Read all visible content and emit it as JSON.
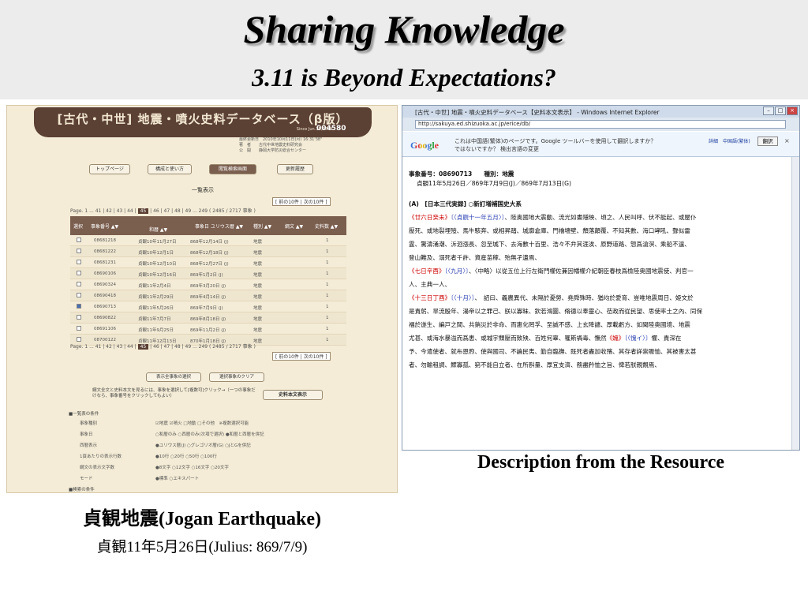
{
  "slide": {
    "title": "Sharing Knowledge",
    "subtitle": "3.11 is Beyond Expectations?",
    "caption_right": "Description from the Resource",
    "caption_left_title": "貞観地震(Jogan Earthquake)",
    "caption_left_date": "貞観11年5月26日(Julius: 869/7/9)"
  },
  "left_db": {
    "header_title": "[古代・中世] 地震・噴火史料データベース（β版）",
    "since": "Since Jun.15,2009",
    "counter": "004580",
    "meta_lines": [
      "最終更新日　2010年10月11日(月) 16:31'38\"",
      "著　者　　古代中世地震史料研究会",
      "公　開　　静岡大学防災総合センター"
    ],
    "buttons": [
      "トップページ",
      "構成と使い方",
      "閲覧検索画面",
      "更新履歴"
    ],
    "section_label": "一覧表示",
    "nav_prev_next": "[ 前の10件 | 次の10件 ]",
    "pager_prefix": "Page. 1 ... 41 | 42 | 43 | 44 |",
    "pager_current": "45",
    "pager_suffix": "| 46 | 47 | 48 | 49 ... 249",
    "pager_count": "( 2485 / 2717 事象 )",
    "table_headers": [
      "選択",
      "事象番号 ▲▼",
      "和暦 ▲▼",
      "事象日 ユリウス暦 ▲▼",
      "種別 ▲▼",
      "綱文 ▲▼",
      "史料数 ▲▼"
    ],
    "rows": [
      {
        "id": "08681218",
        "wareki": "貞観10年11月27日",
        "julius": "868年12月14日 (J)",
        "type": "地震",
        "count": "1",
        "checked": false
      },
      {
        "id": "08681222",
        "wareki": "貞観10年12月1日",
        "julius": "868年12月18日 (J)",
        "type": "地震",
        "count": "1",
        "checked": false
      },
      {
        "id": "08681231",
        "wareki": "貞観10年12月10日",
        "julius": "868年12月27日 (J)",
        "type": "地震",
        "count": "1",
        "checked": false
      },
      {
        "id": "08690106",
        "wareki": "貞観10年12月16日",
        "julius": "869年1月2日 (J)",
        "type": "地震",
        "count": "1",
        "checked": false
      },
      {
        "id": "08690324",
        "wareki": "貞観11年2月4日",
        "julius": "869年3月20日 (J)",
        "type": "地震",
        "count": "1",
        "checked": false
      },
      {
        "id": "08690418",
        "wareki": "貞観11年2月29日",
        "julius": "869年4月14日 (J)",
        "type": "地震",
        "count": "1",
        "checked": false
      },
      {
        "id": "08690713",
        "wareki": "貞観11年5月26日",
        "julius": "869年7月9日 (J)",
        "type": "地震",
        "count": "1",
        "checked": true
      },
      {
        "id": "08690822",
        "wareki": "貞観11年7月7日",
        "julius": "869年8月18日 (J)",
        "type": "地震",
        "count": "1",
        "checked": false
      },
      {
        "id": "08691106",
        "wareki": "貞観11年9月25日",
        "julius": "869年11月2日 (J)",
        "type": "地震",
        "count": "1",
        "checked": false
      },
      {
        "id": "08700122",
        "wareki": "貞観11年12月13日",
        "julius": "870年1月18日 (J)",
        "type": "地震",
        "count": "1",
        "checked": false
      }
    ],
    "select_all": "表示全事象の選択",
    "clear_selection": "選択事象のクリア",
    "note": "綱文全文と史料本文を見るには、事象を選択して[複数可]クリック→（一つの事象だけなら、事象番号をクリックしてもよい）",
    "view_button": "史料本文表示",
    "conditions_title": "■一覧表の条件",
    "conditions": [
      {
        "label": "事象種別",
        "value": "☑地震 ☑噴火 □地動 □その他　※複数選択可能"
      },
      {
        "label": "事象日",
        "value": "○和暦のみ ○西暦のみ(次項で選択) ●和暦と西暦を併記"
      },
      {
        "label": "西暦表示",
        "value": "●ユリウス暦(J) ○グレゴリオ暦(G) ○JとGを併記"
      },
      {
        "label": "1頁あたりの表示行数",
        "value": "●10行 ○20行 ○50行 ○100行"
      },
      {
        "label": "綱文の表示文字数",
        "value": "●8文字 ○12文字 ○16文字 ○20文字"
      },
      {
        "label": "モード",
        "value": "●標準 ○エキスパート"
      }
    ],
    "search_title": "■検索の条件"
  },
  "right_ie": {
    "window_title": "[古代・中世] 地震・噴火史料データベース【史料本文表示】 - Windows Internet Explorer",
    "url": "http://sakuya.ed.shizuoka.ac.jp/erice/db/",
    "google_logo": "Google",
    "translate_line1": "これは中国語(繁体)のページです。Google ツールバーを使用して翻訳しますか？",
    "translate_line2": "ではないですか？ 検出言語の変更",
    "translate_detail": "詳細　中国語(繁体)",
    "translate_button": "翻訳",
    "event_no": "事象番号：08690713　　種別：地震",
    "event_date": "貞観11年5月26日／869年7月9日(J)／869年7月13日(G)",
    "source_title": "(A)　[日本三代実録] ○新訂増補国史大系",
    "lines": [
      "《廿六日癸未》〔〈貞觀十一年五月〉〕、陸奥國地大震動、流光如晝隱映、頃之、人民叫呼、伏不能起、或屋仆",
      "壓死、或地裂埋殪、馬牛駭奔、或相昇踏、城廓倉庫、門櫓墻壁、頽落顛覆、不知其數、海口哮吼、聲似雷",
      "霆、驚濤涌潮、泝洄漲長、忽至城下、去海數十百里、浩々不弁其涯涘、原野道路、惣爲滄溟、乘船不遑、",
      "登山難及、溺死者千許、資産苗稼、殆無孑遺焉、",
      "《七日辛酉》〔〈九月〉〕、〈中略〉以從五位上行左衛門權佐兼因幡權介紀朝臣春枝爲檢陸奥國地震使、判官一",
      "人、主典一人、",
      "《十三日丁酉》〔〈十月〉〕、　詔曰、義農異代、未隔於憂勞、堯舜殊時、猶均於愛育、豈唯地震周日、姫文於",
      "是責躬、旱流殷年、湯帝以之罪己、朕以寡昧、欽若鴻圖、脩德以奉靈心、莅政而從民望、思使率土之內、同保",
      "福於遂生、編戸之間、共銷災於非命、而惠化罔孚、至誠不感、上玄降譴、厚載虧方、如聞陸奥國境、地震",
      "尤甚、或海水暴溢而爲患、或城宇頽壓而致殃、百姓何辜、罹斯禍毒、憮然《媿》〔〈愧イ〉〕懼、責深在",
      "予、今遣使者、就布恩煦、使與國司、不論民夷、勤自臨撫、既死者盡加收殯、其存者詳崇賑恤、其被害太甚",
      "者、勿輸租調、鰥寡孤、窮不能自立者、在所斟量、厚宜支濟、務盡矜恤之旨、俾若朕親覿焉、"
    ]
  }
}
